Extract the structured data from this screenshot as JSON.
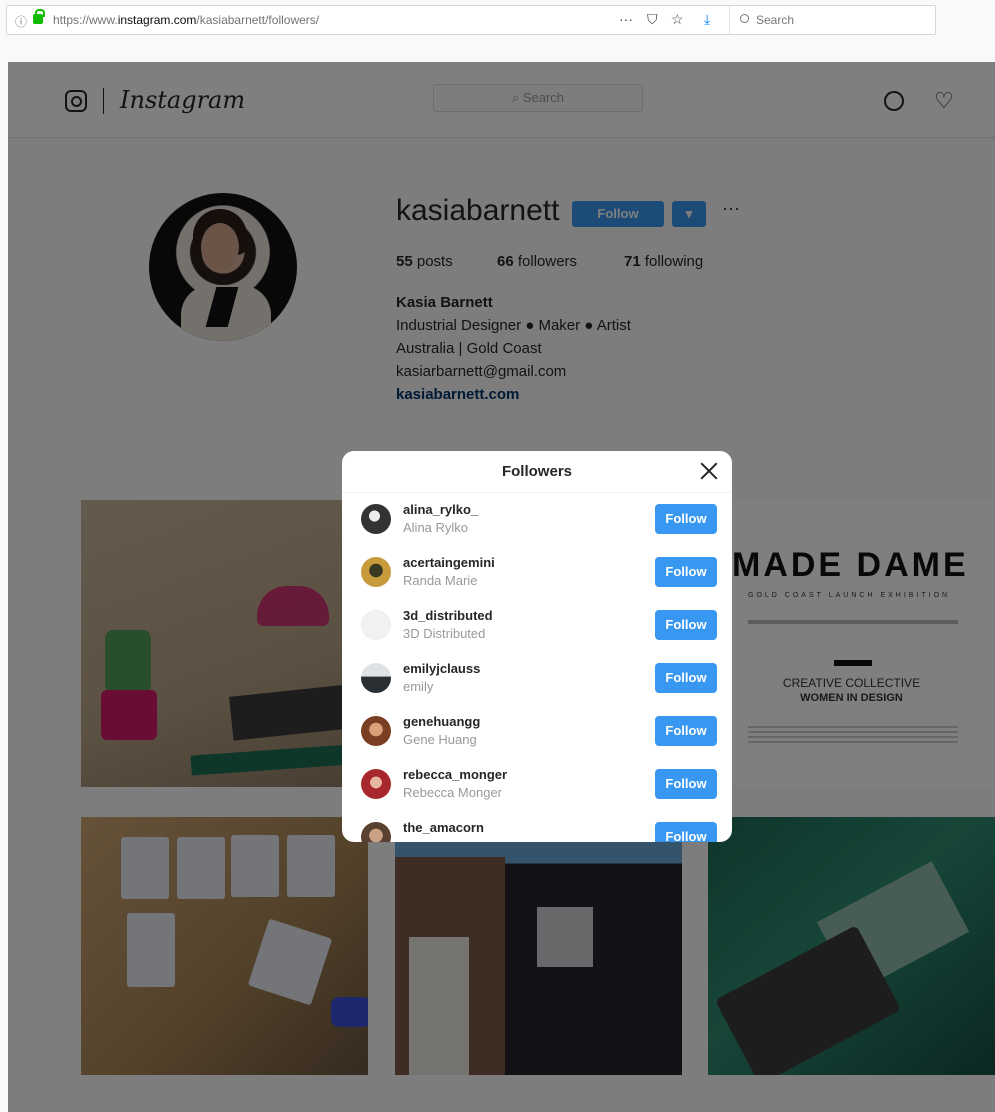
{
  "browser": {
    "url_prefix": "https://www.",
    "url_domain": "instagram.com",
    "url_path": "/kasiabarnett/followers/",
    "info_icon": "ⓘ",
    "more_icon": "···",
    "pocket_icon": "⛉",
    "star_icon": "☆",
    "download_icon": "⤓",
    "search_placeholder": "Search"
  },
  "nav": {
    "logo_text": "Instagram",
    "search_placeholder": "Search",
    "heart_icon": "♡"
  },
  "profile": {
    "username": "kasiabarnett",
    "follow_label": "Follow",
    "dropdown_label": "▾",
    "more_label": "···",
    "posts_count": "55",
    "posts_label": "posts",
    "followers_count": "66",
    "followers_label": "followers",
    "following_count": "71",
    "following_label": "following",
    "full_name": "Kasia Barnett",
    "bio_line1": "Industrial Designer ● Maker ● Artist",
    "bio_line2": "Australia | Gold Coast",
    "bio_line3": "kasiarbarnett@gmail.com",
    "website": "kasiabarnett.com"
  },
  "posts": {
    "tile3_title": "MADE DAME",
    "tile3_sub": "GOLD COAST LAUNCH EXHIBITION",
    "tile3_line1": "CREATIVE COLLECTIVE",
    "tile3_line2": "WOMEN IN DESIGN"
  },
  "modal": {
    "title": "Followers",
    "followers": [
      {
        "username": "alina_rylko_",
        "name": "Alina Rylko",
        "button": "Follow",
        "avatar_color": "#3a3a3a"
      },
      {
        "username": "acertaingemini",
        "name": "Randa Marie",
        "button": "Follow",
        "avatar_color": "#7a8a3a"
      },
      {
        "username": "3d_distributed",
        "name": "3D Distributed",
        "button": "Follow",
        "avatar_color": "#e8e8e8"
      },
      {
        "username": "emilyjclauss",
        "name": "emily",
        "button": "Follow",
        "avatar_color": "#5b6b78"
      },
      {
        "username": "genehuangg",
        "name": "Gene Huang",
        "button": "Follow",
        "avatar_color": "#a0603a"
      },
      {
        "username": "rebecca_monger",
        "name": "Rebecca Monger",
        "button": "Follow",
        "avatar_color": "#b03a3a"
      },
      {
        "username": "the_amacorn",
        "name": "",
        "button": "Follow",
        "avatar_color": "#c9a383"
      }
    ]
  }
}
